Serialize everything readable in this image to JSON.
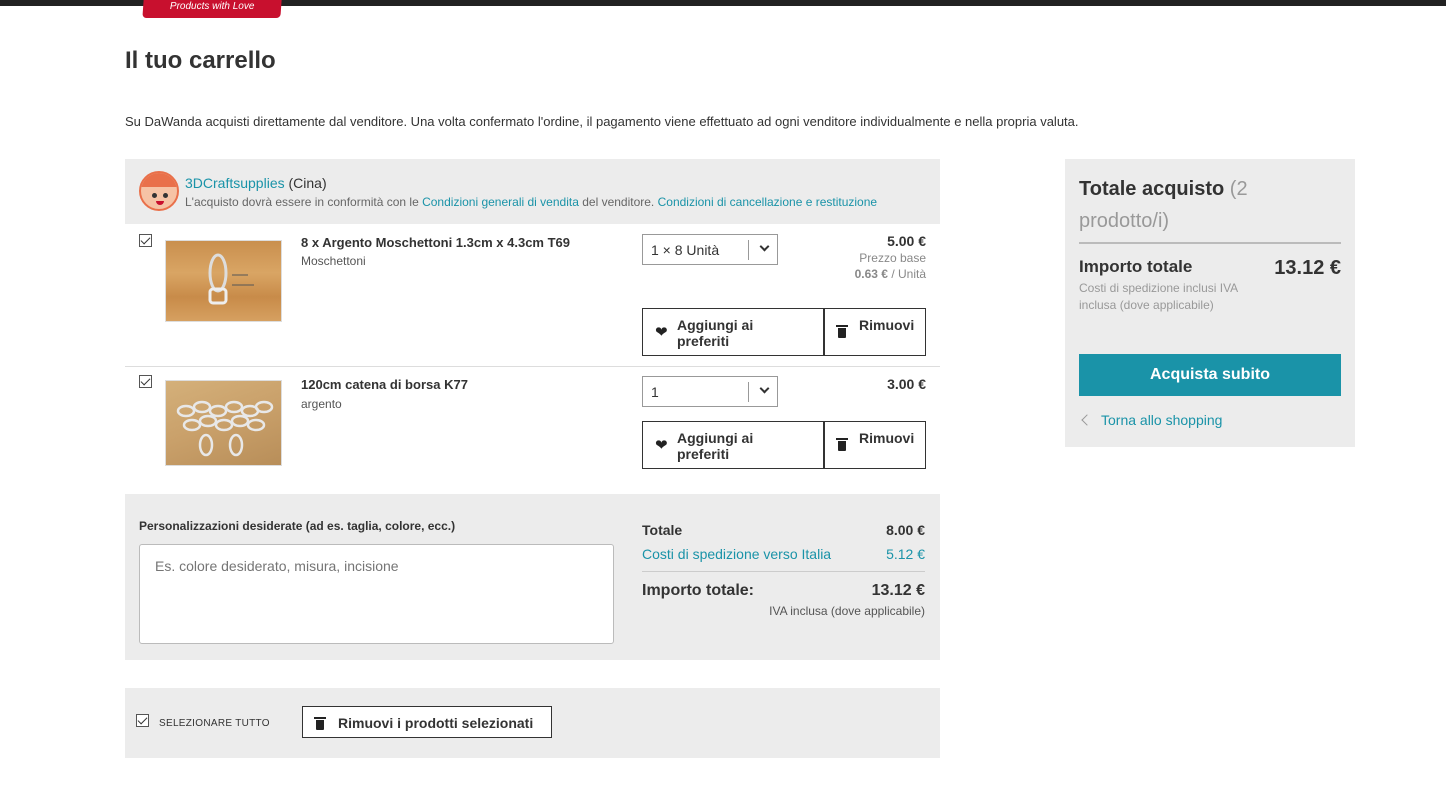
{
  "header": {
    "logo_tagline": "Products with Love"
  },
  "page": {
    "title": "Il tuo carrello",
    "intro": "Su DaWanda acquisti direttamente dal venditore. Una volta confermato l'ordine, il pagamento viene effettuato ad ogni venditore individualmente e nella propria valuta."
  },
  "seller": {
    "name": "3DCraftsupplies",
    "country": "(Cina)",
    "terms_prefix": "L'acquisto dovrà essere in conformità con le",
    "terms_link": "Condizioni generali di vendita",
    "terms_middle": "del venditore.",
    "cancel_link": "Condizioni di cancellazione e restituzione"
  },
  "items": [
    {
      "title": "8 x Argento Moschettoni 1.3cm x 4.3cm T69",
      "subtitle": "Moschettoni",
      "qty": "1 × 8 Unità",
      "price": "5.00 €",
      "base_label": "Prezzo base",
      "unit_price": "0.63 €",
      "unit_label": "/ Unità",
      "fav_label": "Aggiungi ai preferiti",
      "remove_label": "Rimuovi"
    },
    {
      "title": "120cm catena di borsa K77",
      "subtitle": "argento",
      "qty": "1",
      "price": "3.00 €",
      "fav_label": "Aggiungi ai preferiti",
      "remove_label": "Rimuovi"
    }
  ],
  "customization": {
    "label": "Personalizzazioni desiderate (ad es. taglia, colore, ecc.)",
    "placeholder": "Es. colore desiderato, misura, incisione"
  },
  "subtotals": {
    "total_label": "Totale",
    "total_value": "8.00 €",
    "shipping_label": "Costi di spedizione verso Italia",
    "shipping_value": "5.12 €",
    "grand_label": "Importo totale:",
    "grand_value": "13.12 €",
    "vat_note": "IVA inclusa (dove applicabile)"
  },
  "bulk": {
    "select_all_label": "SELEZIONARE TUTTO",
    "remove_selected_label": "Rimuovi i prodotti selezionati"
  },
  "summary": {
    "title": "Totale acquisto",
    "count": "(2 prodotto/i)",
    "amount_label": "Importo totale",
    "amount_value": "13.12 €",
    "note": "Costi di spedizione inclusi IVA inclusa (dove applicabile)",
    "buy_label": "Acquista subito",
    "back_label": "Torna allo shopping"
  },
  "colors": {
    "accent": "#1a93a8",
    "brand": "#c8102e",
    "panel": "#ececec"
  }
}
